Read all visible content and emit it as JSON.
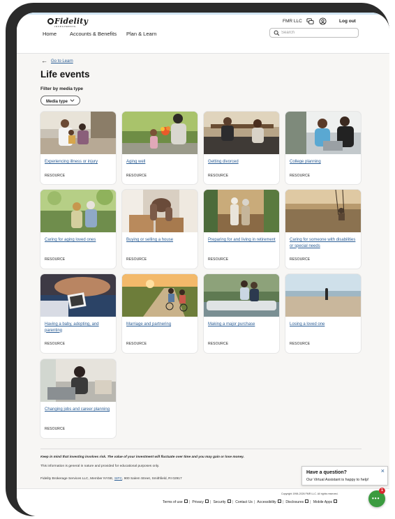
{
  "header": {
    "logo_text": "Fidelity",
    "logo_subtext": "INVESTMENTS",
    "account_name": "FMR LLC",
    "logout_label": "Log out",
    "nav": [
      {
        "label": "Home"
      },
      {
        "label": "Accounts & Benefits"
      },
      {
        "label": "Plan & Learn"
      }
    ],
    "search_placeholder": "Search"
  },
  "main": {
    "back_link": "Go to Learn",
    "page_title": "Life events",
    "filter_label": "Filter by media type",
    "media_type_button": "Media type"
  },
  "cards": [
    {
      "title": "Experiencing illness or injury",
      "type": "RESOURCE",
      "image": "doctor-with-patients-photo"
    },
    {
      "title": "Aging well",
      "type": "RESOURCE",
      "image": "grandmother-with-child-flowers-photo"
    },
    {
      "title": "Getting divorced",
      "type": "RESOURCE",
      "image": "couple-on-couch-photo"
    },
    {
      "title": "College planning",
      "type": "RESOURCE",
      "image": "father-son-laptop-photo"
    },
    {
      "title": "Caring for aging loved ones",
      "type": "RESOURCE",
      "image": "woman-with-elderly-mother-photo"
    },
    {
      "title": "Buying or selling a house",
      "type": "RESOURCE",
      "image": "moving-boxes-photo"
    },
    {
      "title": "Preparing for and living in retirement",
      "type": "RESOURCE",
      "image": "retired-couple-walking-photo"
    },
    {
      "title": "Caring for someone with disabilities or special needs",
      "type": "RESOURCE",
      "image": "field-with-swing-photo"
    },
    {
      "title": "Having a baby, adopting, and parenting",
      "type": "RESOURCE",
      "image": "ultrasound-photo"
    },
    {
      "title": "Marriage and partnering",
      "type": "RESOURCE",
      "image": "couple-cycling-vineyard-photo"
    },
    {
      "title": "Making a major purchase",
      "type": "RESOURCE",
      "image": "couple-on-car-photo"
    },
    {
      "title": "Losing a loved one",
      "type": "RESOURCE",
      "image": "person-on-beach-photo"
    },
    {
      "title": "Changing jobs and career planning",
      "type": "RESOURCE",
      "image": "woman-at-desk-photo"
    }
  ],
  "footer": {
    "disclaimer_1": "Keep in mind that investing involves risk. The value of your investment will fluctuate over time and you may gain or lose money.",
    "disclaimer_2": "This information is general in nature and provided for educational purposes only.",
    "disclaimer_3_before": "Fidelity Brokerage Services LLC, Member NYSE, ",
    "disclaimer_3_link": "SIPC",
    "disclaimer_3_after": ", 900 Salem Street, Smithfield, RI 02917",
    "copyright": "Copyright 1998-2026 FMR LLC. All rights reserved.",
    "links": [
      {
        "label": "Terms of use"
      },
      {
        "label": "Privacy"
      },
      {
        "label": "Security"
      },
      {
        "label": "Contact Us"
      },
      {
        "label": "Accessibility"
      },
      {
        "label": "Disclosures"
      },
      {
        "label": "Mobile Apps"
      }
    ]
  },
  "assistant": {
    "question": "Have a question?",
    "subtitle": "Our Virtual Assistant is happy to help!",
    "badge_count": "1"
  },
  "colors": {
    "link": "#2a5d95",
    "chat": "#3a9b3f",
    "badge": "#d7282f"
  }
}
